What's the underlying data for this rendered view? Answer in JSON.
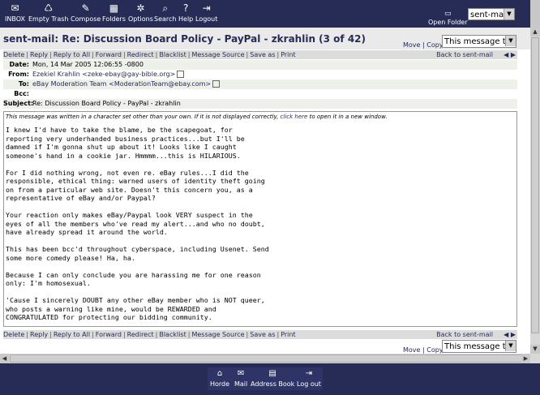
{
  "toolbar": {
    "items": [
      {
        "label": "INBOX",
        "icon": "✉"
      },
      {
        "label": "Empty Trash",
        "icon": "♺"
      },
      {
        "label": "Compose",
        "icon": "✎"
      },
      {
        "label": "Folders",
        "icon": "▦"
      },
      {
        "label": "Options",
        "icon": "✲"
      },
      {
        "label": "Search",
        "icon": "⌕"
      },
      {
        "label": "Help",
        "icon": "?"
      },
      {
        "label": "Logout",
        "icon": "⇥"
      }
    ],
    "open_folder_label": "Open Folder",
    "folder_selected": "sent-mail"
  },
  "message": {
    "title": "sent-mail: Re: Discussion Board Policy - PayPal - zkrahlin (3 of 42)",
    "move_label": "Move",
    "copy_label": "Copy",
    "move_select": "This message to",
    "actions": [
      "Delete",
      "Reply",
      "Reply to All",
      "Forward",
      "Redirect",
      "Blacklist",
      "Message Source",
      "Save as",
      "Print"
    ],
    "back_label": "Back to sent-mail",
    "nav_arrows": "◀ ▶",
    "headers": {
      "date_label": "Date:",
      "date": "Mon, 14 Mar 2005 12:06:55 -0800",
      "from_label": "From:",
      "from": "Ezekiel Krahlin <zeke-ebay@gay-bible.org>",
      "to_label": "To:",
      "to": "eBay Moderation Team <ModerationTeam@ebay.com>",
      "bcc_label": "Bcc:",
      "bcc": "",
      "subject_label": "Subject:",
      "subject": "Re: Discussion Board Policy - PayPal - zkrahlin"
    },
    "charset_note_before": "This message was written in a character set other than your own. If it is not displayed correctly, ",
    "charset_link": "click here",
    "charset_note_after": " to open it in a new window.",
    "body": "I knew I'd have to take the blame, be the scapegoat, for\nreporting very underhanded business practices...but I'll be\ndamned if I'm gonna shut up about it! Looks like I caught\nsomeone's hand in a cookie jar. Hmmmm...this is HILARIOUS.\n\nFor I did nothing wrong, not even re. eBay rules...I did the\nresponsible, ethical thing: warned users of identity theft going\non from a particular web site. Doesn't this concern you, as a\nrepresentative of eBay and/or Paypal?\n\nYour reaction only makes eBay/Paypal look VERY suspect in the\neyes of all the members who've read my alert...and who no doubt,\nhave already spread it around the world.\n\nThis has been bcc'd throughout cyberspace, including Usenet. Send\nsome more comedy please! Ha, ha.\n\nBecause I can only conclude you are harassing me for one reason\nonly: I'm homosexual.\n\n'Cause I sincerely DOUBT any other eBay member who is NOT queer,\nwho posts a warning like mine, would be REWARDED and\nCONGRATULATED for protecting our bidding community."
  },
  "bottom": {
    "items": [
      {
        "label": "Horde",
        "icon": "⌂"
      },
      {
        "label": "Mail",
        "icon": "✉"
      },
      {
        "label": "Address Book",
        "icon": "▤"
      },
      {
        "label": "Log out",
        "icon": "⇥"
      }
    ]
  }
}
